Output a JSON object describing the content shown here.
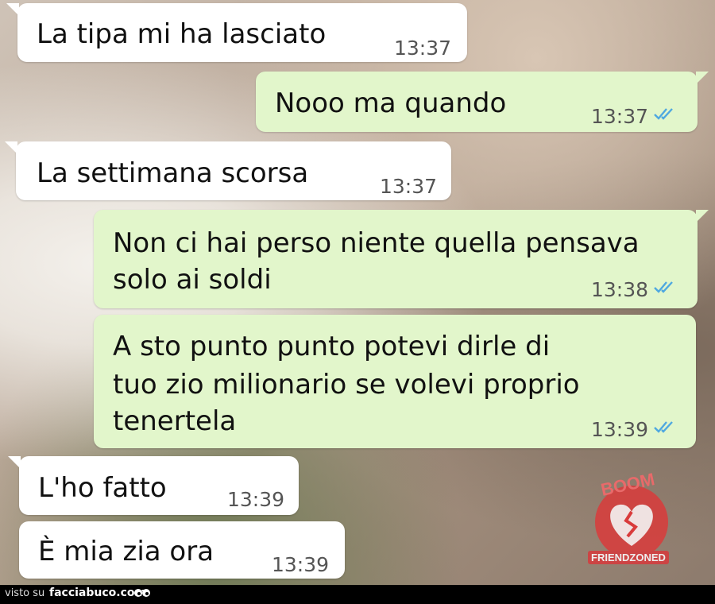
{
  "messages": [
    {
      "side": "in",
      "text": "La tipa mi ha lasciato",
      "time": "13:37"
    },
    {
      "side": "out",
      "text": "Nooo ma quando",
      "time": "13:37",
      "read": true
    },
    {
      "side": "in",
      "text": "La settimana scorsa",
      "time": "13:37"
    },
    {
      "side": "out",
      "lines": [
        "Non ci hai perso niente quella pensava",
        "solo ai soldi"
      ],
      "time": "13:38",
      "read": true
    },
    {
      "side": "out",
      "lines": [
        "A sto punto punto potevi dirle di",
        "tuo zio milionario se volevi proprio",
        "tenertela"
      ],
      "time": "13:39",
      "read": true
    },
    {
      "side": "in",
      "text": "L'ho fatto",
      "time": "13:39"
    },
    {
      "side": "in",
      "text": "È mia zia ora",
      "time": "13:39"
    }
  ],
  "watermark": {
    "top_text": "BOOM",
    "bottom_text": "FRIENDZONED"
  },
  "footer": {
    "visto_label": "visto su",
    "site_label": "facciabuco.com"
  },
  "colors": {
    "incoming": "#ffffff",
    "outgoing": "#e2f6cb",
    "read_ticks": "#4fa8e0"
  },
  "icons": [
    "double-check-icon",
    "broken-heart-icon",
    "eyes-icon"
  ]
}
